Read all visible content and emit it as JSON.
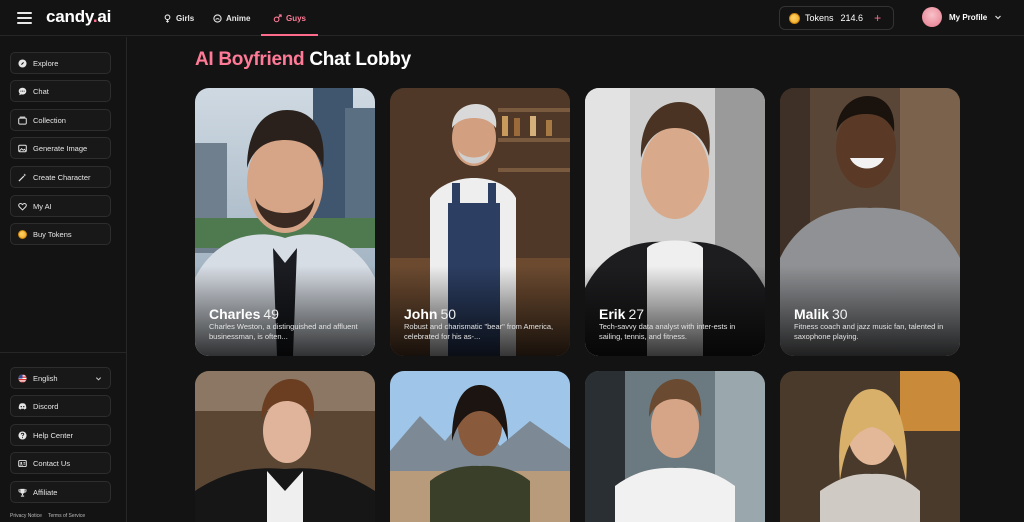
{
  "app": {
    "logo_main": "candy",
    "logo_dot": ".",
    "logo_end": "ai"
  },
  "nav": {
    "tabs": [
      {
        "label": "Girls",
        "icon": "female-icon"
      },
      {
        "label": "Anime",
        "icon": "anime-icon"
      },
      {
        "label": "Guys",
        "icon": "male-icon",
        "active": true
      }
    ]
  },
  "tokens": {
    "label": "Tokens",
    "value": "214.6",
    "add": "+"
  },
  "profile": {
    "label": "My Profile"
  },
  "sidebar": {
    "items": [
      {
        "label": "Explore",
        "icon": "compass-icon"
      },
      {
        "label": "Chat",
        "icon": "chat-bubble-icon"
      },
      {
        "label": "Collection",
        "icon": "collection-icon"
      },
      {
        "label": "Generate Image",
        "icon": "image-icon"
      },
      {
        "label": "Create Character",
        "icon": "magic-wand-icon"
      },
      {
        "label": "My AI",
        "icon": "heart-icon"
      },
      {
        "label": "Buy Tokens",
        "icon": "coin-icon"
      }
    ],
    "bottom": [
      {
        "label": "English",
        "icon": "us-flag-icon"
      },
      {
        "label": "Discord",
        "icon": "discord-icon"
      },
      {
        "label": "Help Center",
        "icon": "help-icon"
      },
      {
        "label": "Contact Us",
        "icon": "contact-icon"
      },
      {
        "label": "Affiliate",
        "icon": "trophy-icon"
      }
    ],
    "footer": {
      "privacy": "Privacy Notice",
      "terms": "Terms of Service"
    }
  },
  "main": {
    "title_accent": "AI Boyfriend",
    "title_rest": "Chat Lobby",
    "cards": [
      {
        "name": "Charles",
        "age": "49",
        "desc": "Charles Weston, a distinguished and affluent businessman, is often..."
      },
      {
        "name": "John",
        "age": "50",
        "desc": "Robust and charismatic \"bear\" from America, celebrated for his as-..."
      },
      {
        "name": "Erik",
        "age": "27",
        "desc": "Tech-savvy data analyst with inter-ests in sailing, tennis, and fitness."
      },
      {
        "name": "Malik",
        "age": "30",
        "desc": "Fitness coach and jazz music fan, talented in saxophone playing."
      },
      {
        "name": "",
        "age": "",
        "desc": ""
      },
      {
        "name": "",
        "age": "",
        "desc": ""
      },
      {
        "name": "",
        "age": "",
        "desc": ""
      },
      {
        "name": "",
        "age": "",
        "desc": ""
      }
    ]
  },
  "colors": {
    "accent": "#ff6b8a",
    "background": "#131313"
  }
}
